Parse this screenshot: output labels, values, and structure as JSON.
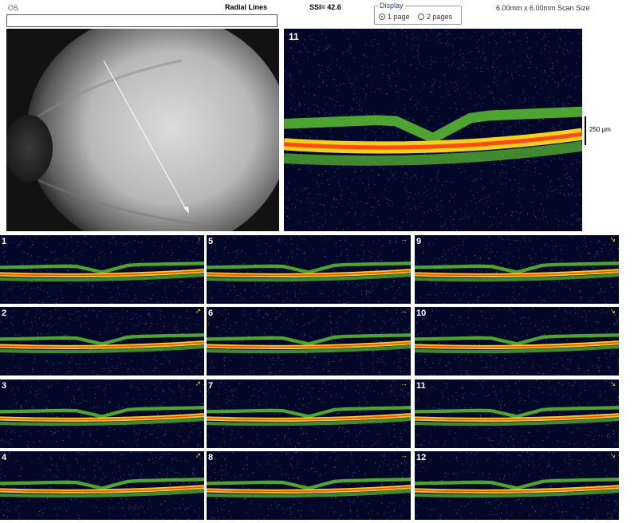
{
  "header": {
    "eye": "OS",
    "protocol": "Radial Lines",
    "ssi": "SSI= 42.6",
    "display": {
      "legend": "Display",
      "options": [
        {
          "label": "1 page",
          "selected": true
        },
        {
          "label": "2 pages",
          "selected": false
        }
      ]
    },
    "scan_size": "6.00mm x 6.00mm Scan Size"
  },
  "main_scan": {
    "number": "11",
    "scale_label": "250 µm"
  },
  "thumbnails": [
    {
      "number": "1",
      "arrow": "↑"
    },
    {
      "number": "5",
      "arrow": "→"
    },
    {
      "number": "9",
      "arrow": "↘"
    },
    {
      "number": "2",
      "arrow": "↗"
    },
    {
      "number": "6",
      "arrow": "→"
    },
    {
      "number": "10",
      "arrow": "↘"
    },
    {
      "number": "3",
      "arrow": "↗"
    },
    {
      "number": "7",
      "arrow": "→"
    },
    {
      "number": "11",
      "arrow": "↘"
    },
    {
      "number": "4",
      "arrow": "↗"
    },
    {
      "number": "8",
      "arrow": "→"
    },
    {
      "number": "12",
      "arrow": "↘"
    }
  ],
  "colors": {
    "background": "#ffffff",
    "scan_bg": "#030828",
    "rpe": "#ff4a10",
    "retina": "#5cc032",
    "noise": "#2a4fb0"
  }
}
